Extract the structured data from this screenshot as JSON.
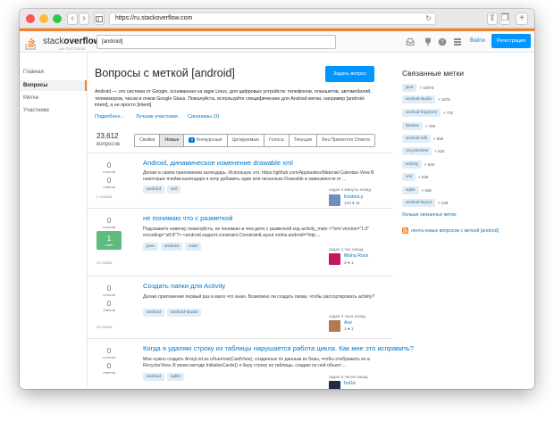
{
  "browser": {
    "url": "https://ru.stackoverflow.com",
    "colors": {
      "close": "#fc5753",
      "minimize": "#fdbc40",
      "maximize": "#34c84a"
    }
  },
  "header": {
    "logo_text_light": "stack",
    "logo_text_bold": "overflow",
    "logo_sub": "НА РУССКОМ",
    "search_value": "[android]",
    "login_label": "Войти",
    "register_label": "Регистрация",
    "icons": [
      "inbox-icon",
      "trophy-icon",
      "help-icon",
      "site-switcher-icon"
    ]
  },
  "leftnav": {
    "items": [
      {
        "label": "Главная",
        "active": false
      },
      {
        "label": "Вопросы",
        "active": true
      },
      {
        "label": "Метки",
        "active": false
      },
      {
        "label": "Участники",
        "active": false
      }
    ]
  },
  "main": {
    "title": "Вопросы с меткой [android]",
    "ask_button": "Задать вопрос",
    "description": "Android — это система от Google, основанная на ядре Linux, для цифровых устройств: телефонов, планшетов, автомобилей, телевизоров, часов и очков Google Glass. Пожалуйста, используйте специфические для Android метки, например [android-intent], а не просто [intent].",
    "more_link": "Подробнее...",
    "top_users_link": "Лучшие участники",
    "synonyms_link": "Синонимы (3)",
    "question_count": "23,612",
    "question_count_label": "вопросов",
    "tabs": [
      {
        "label": "Свойки",
        "active": false,
        "badge": ""
      },
      {
        "label": "Новые",
        "active": true,
        "badge": ""
      },
      {
        "label": "Конкурсные",
        "active": false,
        "badge": "3"
      },
      {
        "label": "Цитируемые",
        "active": false,
        "badge": ""
      },
      {
        "label": "Голоса",
        "active": false,
        "badge": ""
      },
      {
        "label": "Текущие",
        "active": false,
        "badge": ""
      },
      {
        "label": "Без Принятого Ответа",
        "active": false,
        "badge": ""
      }
    ],
    "questions": [
      {
        "votes": "0",
        "votes_label": "голосов",
        "answers": "0",
        "answers_label": "ответов",
        "accepted": false,
        "views": "2 показа",
        "title": "Android, динамическое изменение drawable xml",
        "excerpt": "Делаю в своём приложении календарь. Использую это: https://github.com/Applandeo/Material-Calendar-View В некоторые ячейки календаря я хочу добавить один или несколько Drawable в зависимости от ...",
        "tags": [
          "android",
          "xml"
        ],
        "asked": "задан 4 минуты назад",
        "user": "KirstenLy",
        "rep": "123 ● 11",
        "avatar_color": "#6d8fbf"
      },
      {
        "votes": "0",
        "votes_label": "голосов",
        "answers": "1",
        "answers_label": "ответ",
        "accepted": true,
        "views": "21 показ",
        "title": "не понимаю что с разметкой",
        "excerpt": "Подскажите новичку пожалуйста, не понимаю в чем дело с разметкой код activity_main <?xml version=\"1.0\" encoding=\"utf-8\"?> <android.support.constraint.ConstraintLayout xmlns:android=\"http:...",
        "tags": [
          "java",
          "android",
          "main"
        ],
        "asked": "задан 1 час назад",
        "user": "Misha Rock",
        "rep": "3 ● 1",
        "avatar_color": "#c2185b"
      },
      {
        "votes": "0",
        "votes_label": "голосов",
        "answers": "0",
        "answers_label": "ответов",
        "accepted": false,
        "views": "21 показ",
        "title": "Создать папки для Activity",
        "excerpt": "Делаю приложение первый раз и мало что знаю. Возможно ли создать папки, чтобы рассортировать activity?",
        "tags": [
          "android",
          "android-studio"
        ],
        "asked": "задан 3 часа назад",
        "user": "Ace",
        "rep": "1 ● 1",
        "avatar_color": "#b07a52"
      },
      {
        "votes": "0",
        "votes_label": "голосов",
        "answers": "0",
        "answers_label": "ответов",
        "accepted": false,
        "views": "",
        "title": "Когда я удаляю строку из таблицы нарушается работа цикла. Как мне это исправить?",
        "excerpt": "Мне нужно создать ArrayList из объектов(CardView), созданных по данным из базы, чтобы отображать их в RecyclerView. В моем методе InitializeCards() я беру строку из таблицы, создаю по ней объект ...",
        "tags": [
          "android",
          "sqlite"
        ],
        "asked": "задан 5 часов назад",
        "user": "hoGd",
        "rep": "",
        "avatar_color": "#1f2a44"
      }
    ]
  },
  "sidebar": {
    "title": "Связанные метки",
    "related_tags": [
      {
        "tag": "java",
        "count": "× 10979"
      },
      {
        "tag": "android-studio",
        "count": "× 1676"
      },
      {
        "tag": "android-fragment",
        "count": "× 732"
      },
      {
        "tag": "listview",
        "count": "× 709"
      },
      {
        "tag": "android-sdk",
        "count": "× 655"
      },
      {
        "tag": "recyclerview",
        "count": "× 633"
      },
      {
        "tag": "activity",
        "count": "× 625"
      },
      {
        "tag": "xml",
        "count": "× 546"
      },
      {
        "tag": "sqlite",
        "count": "× 536"
      },
      {
        "tag": "android-layout",
        "count": "× 448"
      }
    ],
    "more_link": "больше связанных меток",
    "feed_label": "лента новых вопросов с меткой [android]"
  }
}
